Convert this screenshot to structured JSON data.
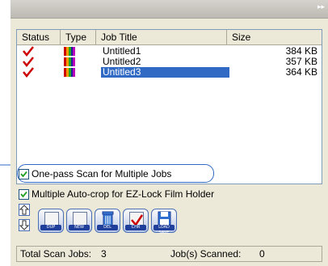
{
  "columns": [
    "Status",
    "Type",
    "Job Title",
    "Size"
  ],
  "jobs": [
    {
      "title": "Untitled1",
      "size": "384 KB",
      "selected": false
    },
    {
      "title": "Untitled2",
      "size": "357 KB",
      "selected": false
    },
    {
      "title": "Untitled3",
      "size": "364 KB",
      "selected": true
    }
  ],
  "options": {
    "one_pass": "One-pass Scan for Multiple Jobs",
    "auto_crop": "Multiple Auto-crop for EZ-Lock Film Holder"
  },
  "buttons": {
    "dup": "DUP",
    "new": "NEW",
    "del": "DEL",
    "chr": "CHR",
    "load_save": "LOAD SAVE"
  },
  "status": {
    "total_label": "Total Scan Jobs:",
    "total_value": "3",
    "scanned_label": "Job(s) Scanned:",
    "scanned_value": "0"
  },
  "colors": {
    "selection": "#316ac5",
    "check": "#cc0000"
  }
}
